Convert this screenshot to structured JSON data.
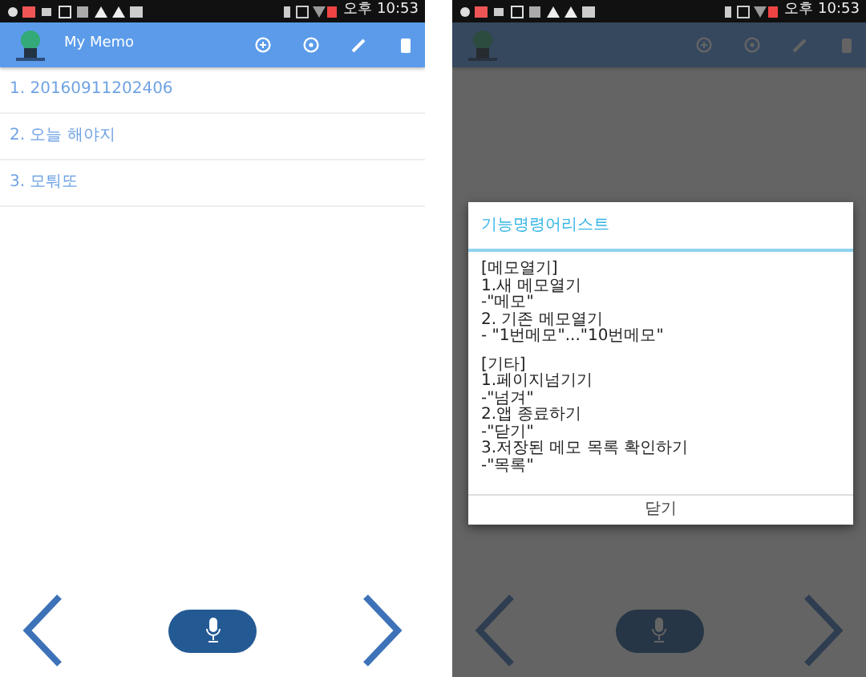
{
  "screens": [
    {
      "status_bar": {
        "time": "오후 10:53"
      },
      "app_bar": {
        "title": "My Memo"
      },
      "memos": [
        "1. 20160911202406",
        "2. 오늘 해야지",
        "3. 모퉈또"
      ],
      "dimmed": false
    },
    {
      "status_bar": {
        "time": "오후 10:53"
      },
      "dimmed": true,
      "dialog": {
        "title": "기능명령어리스트",
        "sections": [
          {
            "heading": "[메모열기]",
            "lines": [
              "1.새 메모열기",
              "-\"메모\"",
              "2. 기존 메모열기",
              "- \"1번메모\"...\"10번메모\""
            ]
          },
          {
            "heading": "[기타]",
            "lines": [
              "1.페이지넘기기",
              "-\"넘겨\"",
              "2.앱 종료하기",
              "-\"닫기\"",
              "3.저장된 메모 목록 확인하기",
              "-\"목록\""
            ]
          }
        ],
        "button": "닫기"
      }
    }
  ]
}
